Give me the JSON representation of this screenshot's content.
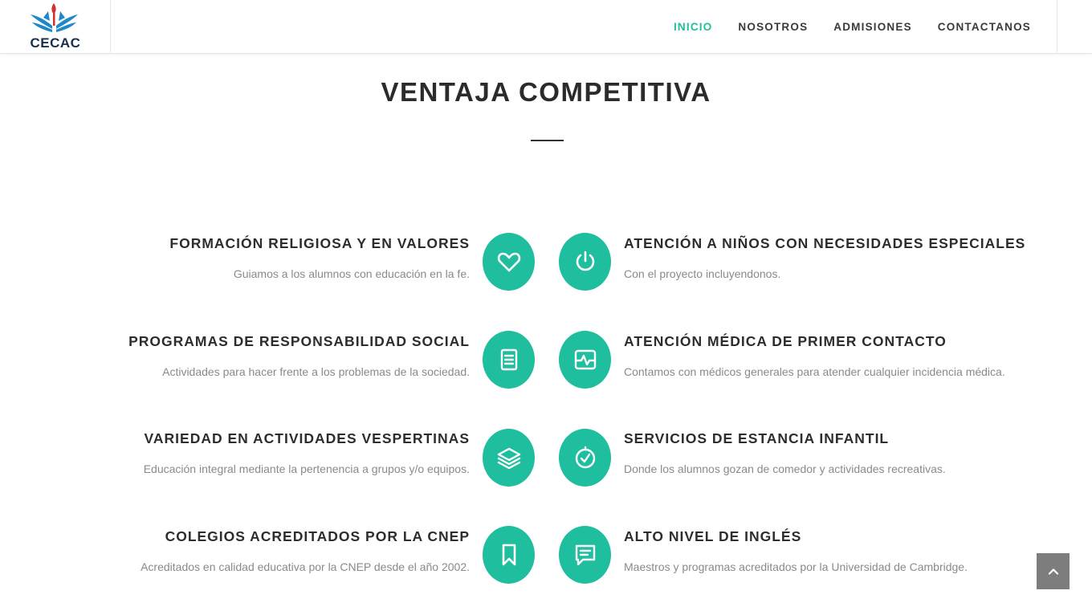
{
  "brand": {
    "logo_text": "CECAC",
    "accent": "#1fbe9e",
    "logo_blue": "#1e88c8",
    "logo_red": "#d32f2f"
  },
  "nav": {
    "items": [
      "INICIO",
      "NOSOTROS",
      "ADMISIONES",
      "CONTACTANOS"
    ],
    "active": "INICIO"
  },
  "section": {
    "title": "VENTAJA COMPETITIVA"
  },
  "features": {
    "left": [
      {
        "title": "FORMACIÓN RELIGIOSA Y EN VALORES",
        "desc": "Guiamos a los alumnos con educación en la fe.",
        "icon": "heart-icon"
      },
      {
        "title": "PROGRAMAS DE RESPONSABILIDAD SOCIAL",
        "desc": "Actividades para hacer frente a los problemas de la sociedad.",
        "icon": "document-icon"
      },
      {
        "title": "VARIEDAD EN ACTIVIDADES VESPERTINAS",
        "desc": "Educación integral mediante la pertenencia a grupos y/o equipos.",
        "icon": "layers-icon"
      },
      {
        "title": "COLEGIOS ACREDITADOS POR LA CNEP",
        "desc": "Acreditados en calidad educativa por la CNEP desde el año 2002.",
        "icon": "bookmark-icon"
      }
    ],
    "right": [
      {
        "title": "ATENCIÓN A NIÑOS CON NECESIDADES ESPECIALES",
        "desc": "Con el proyecto incluyendonos.",
        "icon": "power-icon"
      },
      {
        "title": "ATENCIÓN MÉDICA DE PRIMER CONTACTO",
        "desc": "Contamos con médicos generales para atender cualquier incidencia médica.",
        "icon": "heartbeat-monitor-icon"
      },
      {
        "title": "SERVICIOS DE ESTANCIA INFANTIL",
        "desc": "Donde los alumnos gozan de comedor y actividades recreativas.",
        "icon": "clock-check-icon"
      },
      {
        "title": "ALTO NIVEL DE INGLÉS",
        "desc": "Maestros y programas acreditados por la Universidad de Cambridge.",
        "icon": "chat-icon"
      }
    ]
  },
  "back_to_top": {
    "icon": "chevron-up-icon"
  }
}
